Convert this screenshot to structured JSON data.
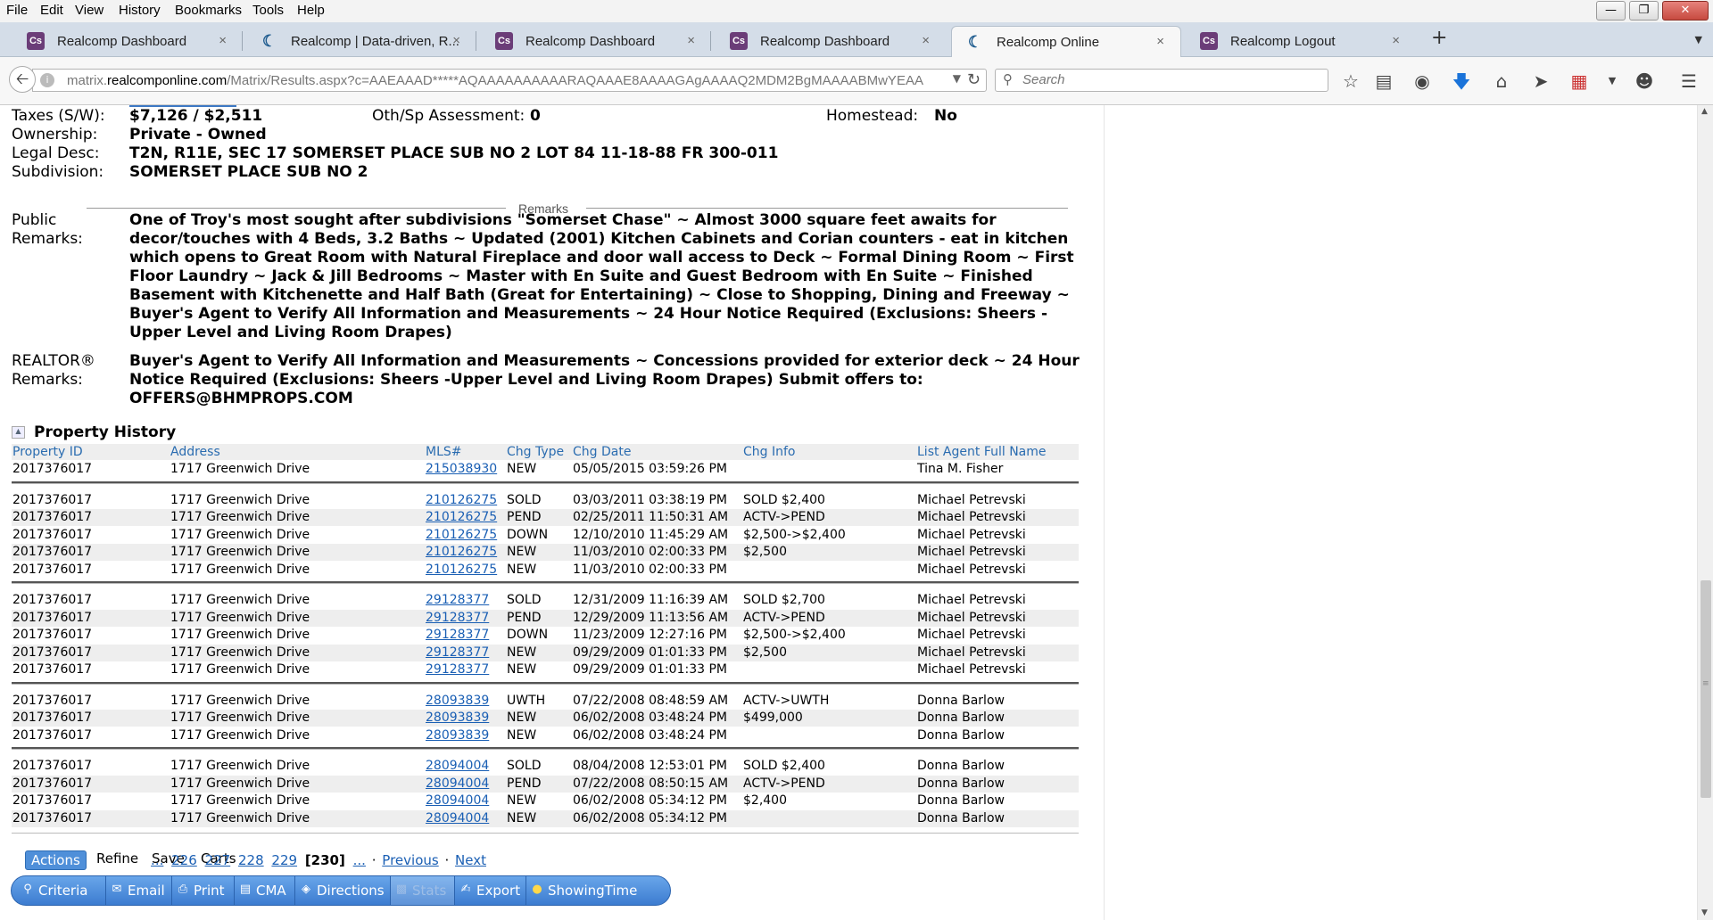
{
  "menubar": {
    "items": [
      "File",
      "Edit",
      "View",
      "History",
      "Bookmarks",
      "Tools",
      "Help"
    ]
  },
  "tabs": [
    {
      "label": "Realcomp Dashboard",
      "icon": "realcomp-icon"
    },
    {
      "label": "Realcomp | Data-driven, R...",
      "icon": "moon-icon"
    },
    {
      "label": "Realcomp Dashboard",
      "icon": "realcomp-icon"
    },
    {
      "label": "Realcomp Dashboard",
      "icon": "realcomp-icon"
    },
    {
      "label": "Realcomp Online",
      "icon": "moon-icon",
      "active": true
    },
    {
      "label": "Realcomp Logout",
      "icon": "realcomp-icon"
    }
  ],
  "tab_icon_text": "Cs",
  "tab_close_glyph": "×",
  "newtab_glyph": "+",
  "url": {
    "prefix": "matrix.",
    "domain": "realcomponline.com",
    "path": "/Matrix/Results.aspx?c=AAEAAAD*****AQAAAAAAAAAARAQAAAE8AAAAGAgAAAAQ2MDM2BgMAAAABMwYEAAAAATE"
  },
  "search": {
    "placeholder": "Search"
  },
  "listing": {
    "taxes_label": "Taxes (S/W):",
    "taxes_value": "$7,126 / $2,511",
    "oth_label": "Oth/Sp Assessment:",
    "oth_value": "0",
    "homestead_label": "Homestead:",
    "homestead_value": "No",
    "ownership_label": "Ownership:",
    "ownership_value": "Private - Owned",
    "legal_label": "Legal Desc:",
    "legal_value": "T2N, R11E, SEC 17 SOMERSET PLACE SUB NO 2 LOT 84 11-18-88 FR 300-011",
    "subdivision_label": "Subdivision:",
    "subdivision_value": "SOMERSET PLACE SUB NO 2",
    "remarks_heading": "Remarks",
    "public_label_1": "Public",
    "public_label_2": "Remarks:",
    "public_remarks": "One of Troy's most sought after subdivisions \"Somerset Chase\" ~ Almost 3000 square feet awaits for decor/touches with 4 Beds, 3.2 Baths ~ Updated (2001) Kitchen Cabinets and Corian counters - eat in kitchen which opens to Great Room with Natural Fireplace and door wall access to Deck ~ Formal Dining Room ~ First Floor Laundry ~ Jack & Jill Bedrooms ~ Master with En Suite and Guest Bedroom with En Suite ~ Finished Basement with Kitchenette and Half Bath (Great for Entertaining) ~ Close to Shopping, Dining and Freeway ~ Buyer's Agent to Verify All Information and Measurements ~ 24 Hour Notice Required (Exclusions: Sheers -Upper Level and Living Room Drapes)",
    "realtor_label_1": "REALTOR®",
    "realtor_label_2": "Remarks:",
    "realtor_remarks": "Buyer's Agent to Verify All Information and Measurements ~ Concessions provided for exterior deck ~ 24 Hour Notice Required (Exclusions: Sheers -Upper Level and Living Room Drapes) Submit offers to: OFFERS@BHMPROPS.COM"
  },
  "history": {
    "title": "Property History",
    "columns": [
      "Property ID",
      "Address",
      "MLS#",
      "Chg Type",
      "Chg Date",
      "Chg Info",
      "List Agent Full Name"
    ],
    "groups": [
      [
        [
          "2017376017",
          "1717 Greenwich Drive",
          "215038930",
          "NEW",
          "05/05/2015 03:59:26 PM",
          "",
          "Tina M. Fisher"
        ]
      ],
      [
        [
          "2017376017",
          "1717 Greenwich Drive",
          "210126275",
          "SOLD",
          "03/03/2011 03:38:19 PM",
          "SOLD $2,400",
          "Michael Petrevski"
        ],
        [
          "2017376017",
          "1717 Greenwich Drive",
          "210126275",
          "PEND",
          "02/25/2011 11:50:31 AM",
          "ACTV->PEND",
          "Michael Petrevski"
        ],
        [
          "2017376017",
          "1717 Greenwich Drive",
          "210126275",
          "DOWN",
          "12/10/2010 11:45:29 AM",
          "$2,500->$2,400",
          "Michael Petrevski"
        ],
        [
          "2017376017",
          "1717 Greenwich Drive",
          "210126275",
          "NEW",
          "11/03/2010 02:00:33 PM",
          "$2,500",
          "Michael Petrevski"
        ],
        [
          "2017376017",
          "1717 Greenwich Drive",
          "210126275",
          "NEW",
          "11/03/2010 02:00:33 PM",
          "",
          "Michael Petrevski"
        ]
      ],
      [
        [
          "2017376017",
          "1717 Greenwich Drive",
          "29128377",
          "SOLD",
          "12/31/2009 11:16:39 AM",
          "SOLD $2,700",
          "Michael Petrevski"
        ],
        [
          "2017376017",
          "1717 Greenwich Drive",
          "29128377",
          "PEND",
          "12/29/2009 11:13:56 AM",
          "ACTV->PEND",
          "Michael Petrevski"
        ],
        [
          "2017376017",
          "1717 Greenwich Drive",
          "29128377",
          "DOWN",
          "11/23/2009 12:27:16 PM",
          "$2,500->$2,400",
          "Michael Petrevski"
        ],
        [
          "2017376017",
          "1717 Greenwich Drive",
          "29128377",
          "NEW",
          "09/29/2009 01:01:33 PM",
          "$2,500",
          "Michael Petrevski"
        ],
        [
          "2017376017",
          "1717 Greenwich Drive",
          "29128377",
          "NEW",
          "09/29/2009 01:01:33 PM",
          "",
          "Michael Petrevski"
        ]
      ],
      [
        [
          "2017376017",
          "1717 Greenwich Drive",
          "28093839",
          "UWTH",
          "07/22/2008 08:48:59 AM",
          "ACTV->UWTH",
          "Donna Barlow"
        ],
        [
          "2017376017",
          "1717 Greenwich Drive",
          "28093839",
          "NEW",
          "06/02/2008 03:48:24 PM",
          "$499,000",
          "Donna Barlow"
        ],
        [
          "2017376017",
          "1717 Greenwich Drive",
          "28093839",
          "NEW",
          "06/02/2008 03:48:24 PM",
          "",
          "Donna Barlow"
        ]
      ],
      [
        [
          "2017376017",
          "1717 Greenwich Drive",
          "28094004",
          "SOLD",
          "08/04/2008 12:53:01 PM",
          "SOLD $2,400",
          "Donna Barlow"
        ],
        [
          "2017376017",
          "1717 Greenwich Drive",
          "28094004",
          "PEND",
          "07/22/2008 08:50:15 AM",
          "ACTV->PEND",
          "Donna Barlow"
        ],
        [
          "2017376017",
          "1717 Greenwich Drive",
          "28094004",
          "NEW",
          "06/02/2008 05:34:12 PM",
          "$2,400",
          "Donna Barlow"
        ],
        [
          "2017376017",
          "1717 Greenwich Drive",
          "28094004",
          "NEW",
          "06/02/2008 05:34:12 PM",
          "",
          "Donna Barlow"
        ]
      ]
    ]
  },
  "actions": {
    "actions": "Actions",
    "refine": "Refine",
    "save": "Save",
    "carts": "Carts"
  },
  "pager": {
    "ellipsis": "...",
    "pages": [
      "226",
      "227",
      "228",
      "229"
    ],
    "current": "[230]",
    "sep": "·",
    "previous": "Previous",
    "next": "Next"
  },
  "toolbar": [
    {
      "label": "Criteria",
      "icon": "search-icon"
    },
    {
      "label": "Email",
      "icon": "email-icon"
    },
    {
      "label": "Print",
      "icon": "print-icon"
    },
    {
      "label": "CMA",
      "icon": "cma-icon"
    },
    {
      "label": "Directions",
      "icon": "directions-icon"
    },
    {
      "label": "Stats",
      "icon": "stats-icon",
      "disabled": true
    },
    {
      "label": "Export",
      "icon": "export-icon"
    },
    {
      "label": "ShowingTime",
      "icon": "showingtime-icon"
    }
  ],
  "colors": {
    "link": "#1a5fb4",
    "header_text": "#2a6cb0",
    "toolbar": "#3c7cd0"
  }
}
